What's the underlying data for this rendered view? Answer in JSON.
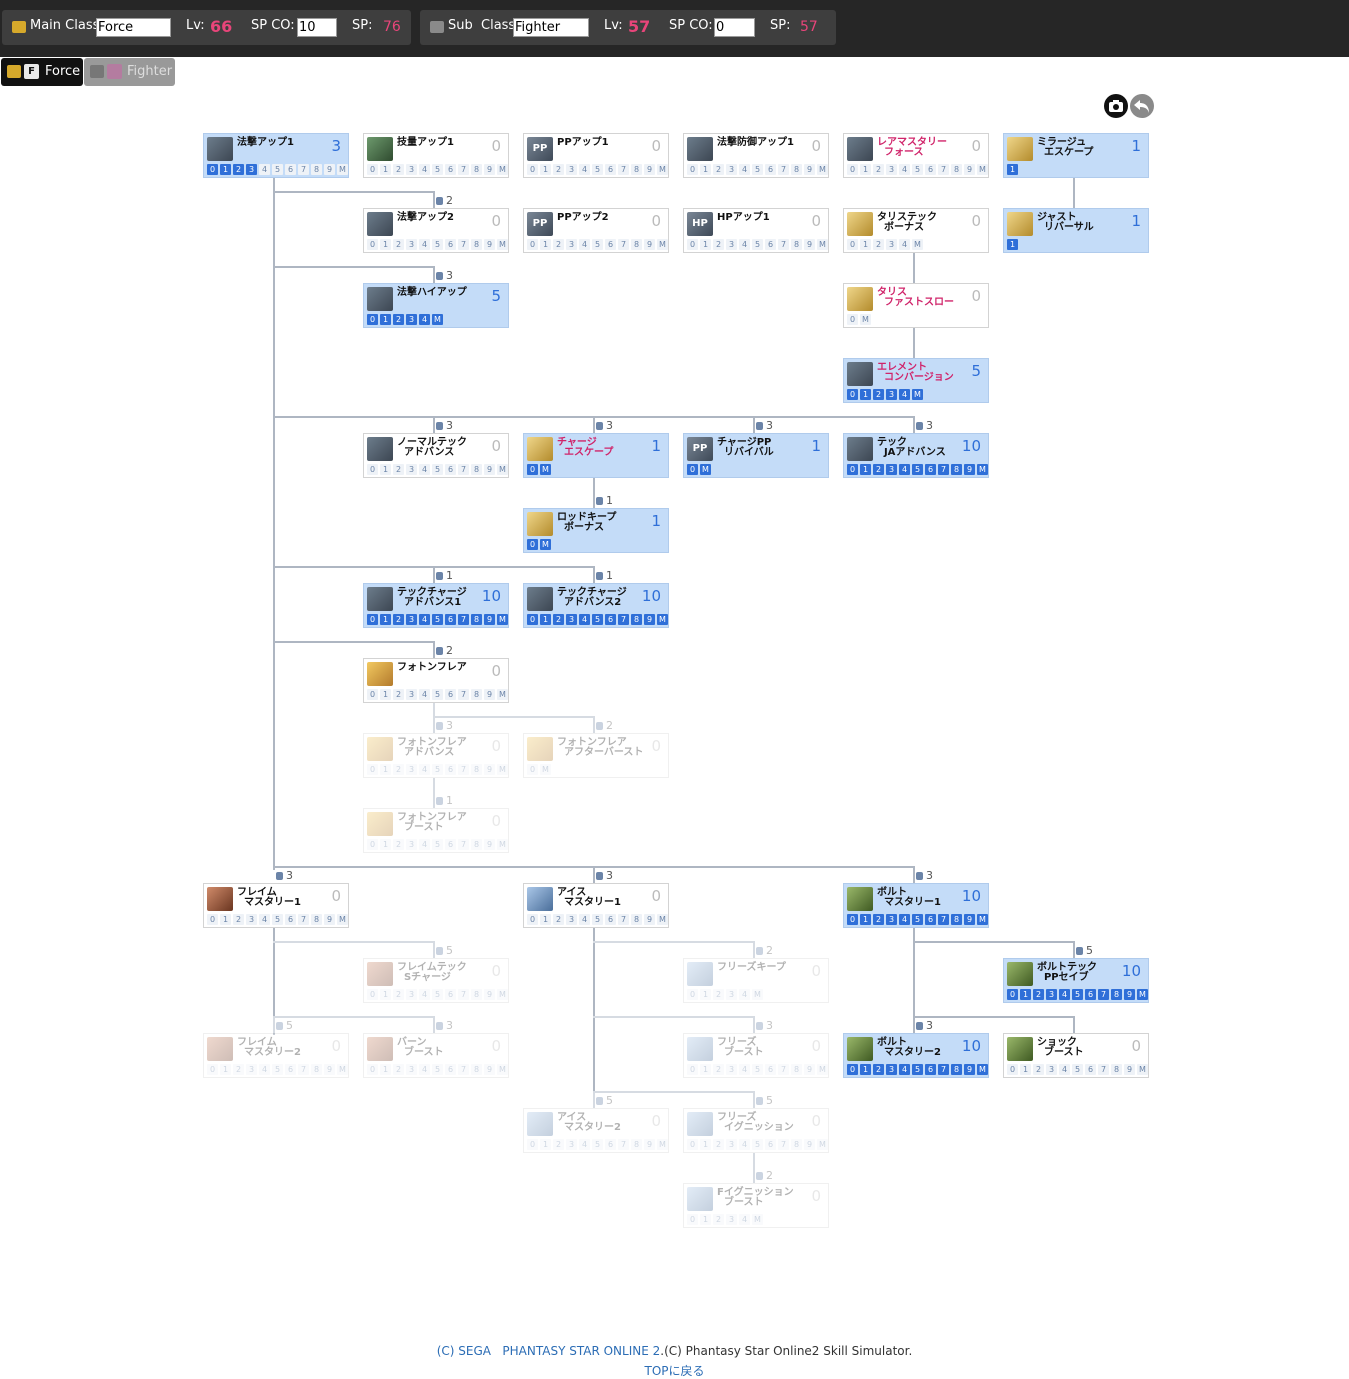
{
  "main_class": {
    "label": "Main Class",
    "value": "Force",
    "lv_label": "Lv:",
    "lv": "66",
    "spco_label": "SP CO:",
    "spco": "10",
    "sp_label": "SP:",
    "sp": "76"
  },
  "sub_class": {
    "label": "Sub  Class",
    "value": "Fighter",
    "lv_label": "Lv:",
    "lv": "57",
    "spco_label": "SP CO:",
    "spco": "0",
    "sp_label": "SP:",
    "sp": "57"
  },
  "tabs": [
    {
      "label": "Force",
      "active": true
    },
    {
      "label": "Fighter",
      "active": false
    }
  ],
  "toolbar": {
    "screenshot_icon": "camera-icon",
    "undo_icon": "undo-icon"
  },
  "colors": {
    "learned": "#c4dcf8",
    "level_highlight": "#2f6fd8",
    "skill_red": "#d0246a",
    "lv_pink": "#e8457a"
  },
  "skills": [
    {
      "id": "s1",
      "name": "法撃アップ1",
      "level": "3",
      "icon": "wand-icon",
      "levels": [
        "0",
        "1",
        "2",
        "3",
        "4",
        "5",
        "6",
        "7",
        "8",
        "9",
        "M"
      ],
      "selected": 3
    },
    {
      "id": "s2",
      "name": "技量アップ1",
      "level": "0",
      "icon": "dex-icon",
      "levels": [
        "0",
        "1",
        "2",
        "3",
        "4",
        "5",
        "6",
        "7",
        "8",
        "9",
        "M"
      ],
      "selected": -1
    },
    {
      "id": "s3",
      "name": "PPアップ1",
      "level": "0",
      "icon": "pp-icon",
      "levels": [
        "0",
        "1",
        "2",
        "3",
        "4",
        "5",
        "6",
        "7",
        "8",
        "9",
        "M"
      ],
      "selected": -1
    },
    {
      "id": "s4",
      "name": "法撃防御アップ1",
      "level": "0",
      "icon": "wand-icon",
      "levels": [
        "0",
        "1",
        "2",
        "3",
        "4",
        "5",
        "6",
        "7",
        "8",
        "9",
        "M"
      ],
      "selected": -1
    },
    {
      "id": "s5",
      "name": "レアマスタリー\n  フォース",
      "level": "0",
      "icon": "wand-icon",
      "levels": [
        "0",
        "1",
        "2",
        "3",
        "4",
        "5",
        "6",
        "7",
        "8",
        "9",
        "M"
      ],
      "selected": -1
    },
    {
      "id": "s6",
      "name": "ミラージュ\n  エスケープ",
      "level": "1",
      "icon": "boots-icon",
      "levels": [
        "1"
      ],
      "selected": 0
    },
    {
      "id": "s7",
      "name": "法撃アップ2",
      "level": "0",
      "icon": "wand-icon",
      "levels": [
        "0",
        "1",
        "2",
        "3",
        "4",
        "5",
        "6",
        "7",
        "8",
        "9",
        "M"
      ],
      "selected": -1
    },
    {
      "id": "s8",
      "name": "PPアップ2",
      "level": "0",
      "icon": "pp-icon",
      "levels": [
        "0",
        "1",
        "2",
        "3",
        "4",
        "5",
        "6",
        "7",
        "8",
        "9",
        "M"
      ],
      "selected": -1
    },
    {
      "id": "s9",
      "name": "HPアップ1",
      "level": "0",
      "icon": "hp-icon",
      "levels": [
        "0",
        "1",
        "2",
        "3",
        "4",
        "5",
        "6",
        "7",
        "8",
        "9",
        "M"
      ],
      "selected": -1
    },
    {
      "id": "s10",
      "name": "タリステック\n  ボーナス",
      "level": "0",
      "icon": "talis-icon",
      "levels": [
        "0",
        "1",
        "2",
        "3",
        "4",
        "M"
      ],
      "selected": -1
    },
    {
      "id": "s11",
      "name": "ジャスト\n  リバーサル",
      "level": "1",
      "icon": "boots-icon",
      "levels": [
        "1"
      ],
      "selected": 0
    },
    {
      "id": "s12",
      "name": "法撃ハイアップ",
      "level": "5",
      "icon": "wand-icon",
      "levels": [
        "0",
        "1",
        "2",
        "3",
        "4",
        "M"
      ],
      "selected": 5
    },
    {
      "id": "s13",
      "name": "タリス\n  ファストスロー",
      "level": "0",
      "icon": "talis-icon",
      "levels": [
        "0",
        "M"
      ],
      "selected": -1
    },
    {
      "id": "s14",
      "name": "エレメント\n  コンバージョン",
      "level": "5",
      "icon": "wand-icon",
      "levels": [
        "0",
        "1",
        "2",
        "3",
        "4",
        "M"
      ],
      "selected": 5
    },
    {
      "id": "s15",
      "name": "ノーマルテック\n  アドバンス",
      "level": "0",
      "icon": "wand-icon",
      "levels": [
        "0",
        "1",
        "2",
        "3",
        "4",
        "5",
        "6",
        "7",
        "8",
        "9",
        "M"
      ],
      "selected": -1
    },
    {
      "id": "s16",
      "name": "チャージ\n  エスケープ",
      "level": "1",
      "icon": "escape-icon",
      "levels": [
        "0",
        "M"
      ],
      "selected": 1
    },
    {
      "id": "s17",
      "name": "チャージPP\n  リバイバル",
      "level": "1",
      "icon": "pp-icon",
      "levels": [
        "0",
        "M"
      ],
      "selected": 1
    },
    {
      "id": "s18",
      "name": "テック\n  JAアドバンス",
      "level": "10",
      "icon": "wand-icon",
      "levels": [
        "0",
        "1",
        "2",
        "3",
        "4",
        "5",
        "6",
        "7",
        "8",
        "9",
        "M"
      ],
      "selected": 10
    },
    {
      "id": "s19",
      "name": "ロッドキープ\n  ボーナス",
      "level": "1",
      "icon": "rod-icon",
      "levels": [
        "0",
        "M"
      ],
      "selected": 1
    },
    {
      "id": "s20",
      "name": "テックチャージ\n  アドバンス1",
      "level": "10",
      "icon": "wand-icon",
      "levels": [
        "0",
        "1",
        "2",
        "3",
        "4",
        "5",
        "6",
        "7",
        "8",
        "9",
        "M"
      ],
      "selected": 10
    },
    {
      "id": "s21",
      "name": "テックチャージ\n  アドバンス2",
      "level": "10",
      "icon": "wand-icon",
      "levels": [
        "0",
        "1",
        "2",
        "3",
        "4",
        "5",
        "6",
        "7",
        "8",
        "9",
        "M"
      ],
      "selected": 10
    },
    {
      "id": "s22",
      "name": "フォトンフレア",
      "level": "0",
      "icon": "photon-flare-icon",
      "levels": [
        "0",
        "1",
        "2",
        "3",
        "4",
        "5",
        "6",
        "7",
        "8",
        "9",
        "M"
      ],
      "selected": -1
    },
    {
      "id": "s23",
      "name": "フォトンフレア\n  アドバンス",
      "level": "0",
      "icon": "photon-flare-icon",
      "levels": [
        "0",
        "1",
        "2",
        "3",
        "4",
        "5",
        "6",
        "7",
        "8",
        "9",
        "M"
      ],
      "selected": -1
    },
    {
      "id": "s24",
      "name": "フォトンフレア\n  アフターバースト",
      "level": "0",
      "icon": "photon-flare-icon",
      "levels": [
        "0",
        "M"
      ],
      "selected": -1
    },
    {
      "id": "s25",
      "name": "フォトンフレア\n  ブースト",
      "level": "0",
      "icon": "photon-flare-icon",
      "levels": [
        "0",
        "1",
        "2",
        "3",
        "4",
        "5",
        "6",
        "7",
        "8",
        "9",
        "M"
      ],
      "selected": -1
    },
    {
      "id": "s26",
      "name": "フレイム\n  マスタリー1",
      "level": "0",
      "icon": "fire-icon",
      "levels": [
        "0",
        "1",
        "2",
        "3",
        "4",
        "5",
        "6",
        "7",
        "8",
        "9",
        "M"
      ],
      "selected": -1
    },
    {
      "id": "s27",
      "name": "アイス\n  マスタリー1",
      "level": "0",
      "icon": "ice-icon",
      "levels": [
        "0",
        "1",
        "2",
        "3",
        "4",
        "5",
        "6",
        "7",
        "8",
        "9",
        "M"
      ],
      "selected": -1
    },
    {
      "id": "s28",
      "name": "ボルト\n  マスタリー1",
      "level": "10",
      "icon": "volt-icon",
      "levels": [
        "0",
        "1",
        "2",
        "3",
        "4",
        "5",
        "6",
        "7",
        "8",
        "9",
        "M"
      ],
      "selected": 10
    },
    {
      "id": "s29",
      "name": "フレイムテック\n  Sチャージ",
      "level": "0",
      "icon": "fire-icon",
      "levels": [
        "0",
        "1",
        "2",
        "3",
        "4",
        "5",
        "6",
        "7",
        "8",
        "9",
        "M"
      ],
      "selected": -1
    },
    {
      "id": "s30",
      "name": "フリーズキープ",
      "level": "0",
      "icon": "ice-icon",
      "levels": [
        "0",
        "1",
        "2",
        "3",
        "4",
        "M"
      ],
      "selected": -1
    },
    {
      "id": "s31",
      "name": "ボルトテック\n  PPセイブ",
      "level": "10",
      "icon": "volt-icon",
      "levels": [
        "0",
        "1",
        "2",
        "3",
        "4",
        "5",
        "6",
        "7",
        "8",
        "9",
        "M"
      ],
      "selected": 10
    },
    {
      "id": "s32",
      "name": "フレイム\n  マスタリー2",
      "level": "0",
      "icon": "fire-icon",
      "levels": [
        "0",
        "1",
        "2",
        "3",
        "4",
        "5",
        "6",
        "7",
        "8",
        "9",
        "M"
      ],
      "selected": -1
    },
    {
      "id": "s33",
      "name": "バーン\n  ブースト",
      "level": "0",
      "icon": "fire-icon",
      "levels": [
        "0",
        "1",
        "2",
        "3",
        "4",
        "5",
        "6",
        "7",
        "8",
        "9",
        "M"
      ],
      "selected": -1
    },
    {
      "id": "s34",
      "name": "フリーズ\n  ブースト",
      "level": "0",
      "icon": "ice-icon",
      "levels": [
        "0",
        "1",
        "2",
        "3",
        "4",
        "5",
        "6",
        "7",
        "8",
        "9",
        "M"
      ],
      "selected": -1
    },
    {
      "id": "s35",
      "name": "ボルト\n  マスタリー2",
      "level": "10",
      "icon": "volt-icon",
      "levels": [
        "0",
        "1",
        "2",
        "3",
        "4",
        "5",
        "6",
        "7",
        "8",
        "9",
        "M"
      ],
      "selected": 10
    },
    {
      "id": "s36",
      "name": "ショック\n  ブースト",
      "level": "0",
      "icon": "volt-icon",
      "levels": [
        "0",
        "1",
        "2",
        "3",
        "4",
        "5",
        "6",
        "7",
        "8",
        "9",
        "M"
      ],
      "selected": -1
    },
    {
      "id": "s37",
      "name": "アイス\n  マスタリー2",
      "level": "0",
      "icon": "ice-icon",
      "levels": [
        "0",
        "1",
        "2",
        "3",
        "4",
        "5",
        "6",
        "7",
        "8",
        "9",
        "M"
      ],
      "selected": -1
    },
    {
      "id": "s38",
      "name": "フリーズ\n  イグニッション",
      "level": "0",
      "icon": "ice-icon",
      "levels": [
        "0",
        "1",
        "2",
        "3",
        "4",
        "5",
        "6",
        "7",
        "8",
        "9",
        "M"
      ],
      "selected": -1
    },
    {
      "id": "s39",
      "name": "Fイグニッション\n  ブースト",
      "level": "0",
      "icon": "ice-icon",
      "levels": [
        "0",
        "1",
        "2",
        "3",
        "4",
        "M"
      ],
      "selected": -1
    }
  ],
  "requirements": [
    "2",
    "3",
    "3",
    "3",
    "3",
    "3",
    "1",
    "1",
    "1",
    "2",
    "3",
    "2",
    "1",
    "3",
    "3",
    "3",
    "5",
    "2",
    "5",
    "5",
    "3",
    "3",
    "3",
    "5",
    "5",
    "2"
  ],
  "footer": {
    "copy1": "(C) SEGA",
    "game": "PHANTASY STAR ONLINE 2",
    "copy2": ".(C) Phantasy Star Online2 Skill Simulator.",
    "top_link": "TOPに戻る"
  }
}
